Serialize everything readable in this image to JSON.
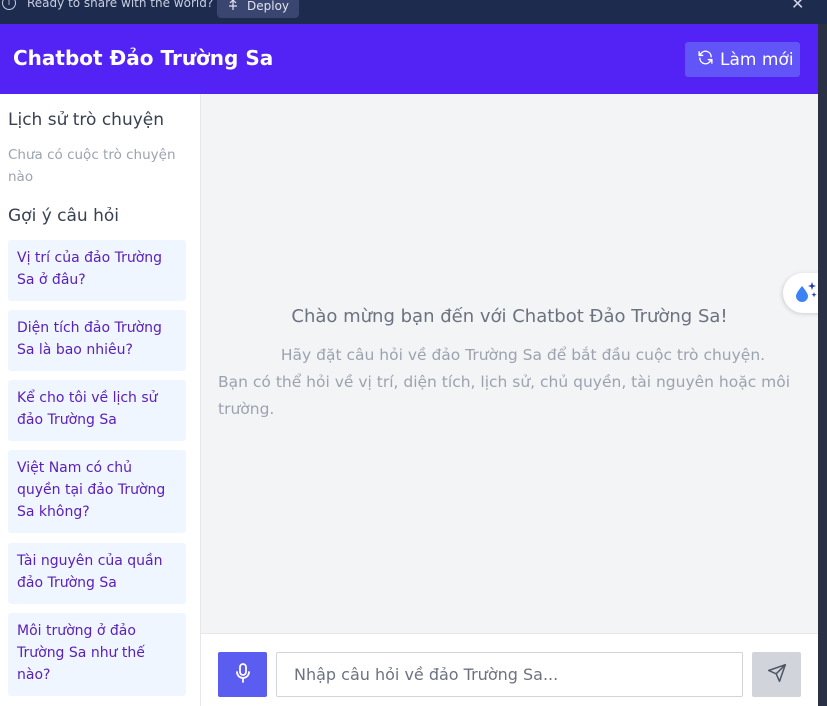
{
  "deploy_bar": {
    "ready_text": "Ready to share with the world?",
    "deploy_label": "Deploy"
  },
  "header": {
    "title": "Chatbot Đảo Trường Sa",
    "refresh_label": "Làm mới"
  },
  "sidebar": {
    "history_title": "Lịch sử trò chuyện",
    "history_empty": "Chưa có cuộc trò chuyện nào",
    "suggest_title": "Gợi ý câu hỏi",
    "suggestions": [
      "Vị trí của đảo Trường Sa ở đâu?",
      "Diện tích đảo Trường Sa là bao nhiêu?",
      "Kể cho tôi về lịch sử đảo Trường Sa",
      "Việt Nam có chủ quyền tại đảo Trường Sa không?",
      "Tài nguyên của quần đảo Trường Sa",
      "Môi trường ở đảo Trường Sa như thế nào?"
    ]
  },
  "chat": {
    "welcome_title": "Chào mừng bạn đến với Chatbot Đảo Trường Sa!",
    "welcome_line1": "Hãy đặt câu hỏi về đảo Trường Sa để bắt đầu cuộc trò chuyện.",
    "welcome_line2": "Bạn có thể hỏi về vị trí, diện tích, lịch sử, chủ quyền, tài nguyên hoặc môi trường."
  },
  "input": {
    "placeholder": "Nhập câu hỏi về đảo Trường Sa..."
  },
  "colors": {
    "header_bg": "#5322f5",
    "accent": "#5b5cf0",
    "suggest_bg": "#eff6ff",
    "suggest_text": "#5b21b6"
  }
}
